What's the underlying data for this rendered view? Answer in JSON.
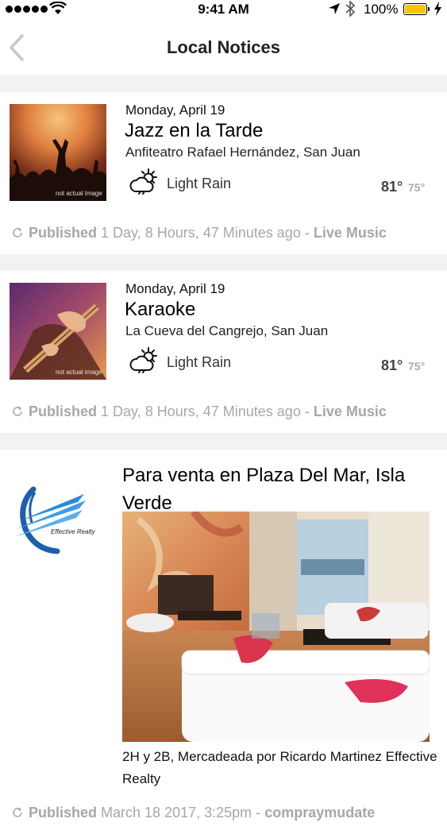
{
  "status_bar": {
    "time": "9:41 AM",
    "battery": "100%"
  },
  "header": {
    "title": "Local Notices"
  },
  "notices": [
    {
      "date": "Monday, April 19",
      "title": "Jazz en la Tarde",
      "venue": "Anfiteatro Rafael Hernández, San Juan",
      "thumb_note": "not actual image",
      "weather": {
        "icon": "partly-cloudy-icon",
        "condition": "Light Rain",
        "high": "81°",
        "low": "75°"
      },
      "published_label": "Published",
      "published_time": "1 Day, 8 Hours, 47 Minutes ago",
      "separator": "-",
      "category": "Live Music"
    },
    {
      "date": "Monday, April 19",
      "title": "Karaoke",
      "venue": "La Cueva del Cangrejo, San Juan",
      "thumb_note": "not actual image",
      "weather": {
        "icon": "partly-cloudy-icon",
        "condition": "Light Rain",
        "high": "81°",
        "low": "75°"
      },
      "published_label": "Published",
      "published_time": "1 Day, 8 Hours, 47 Minutes ago",
      "separator": "-",
      "category": "Live Music"
    }
  ],
  "listing": {
    "logo_text": "Effective Realty",
    "title": "Para venta en Plaza Del Mar, Isla Verde",
    "description": "2H y 2B, Mercadeada por Ricardo Martinez Effective Realty",
    "published_label": "Published",
    "published_time": "March 18 2017, 3:25pm",
    "separator": "-",
    "category": "compraymudate"
  },
  "colors": {
    "meta_gray": "#a7a7a7",
    "battery": "#f7c600",
    "separator_bg": "#f2f2f2"
  }
}
